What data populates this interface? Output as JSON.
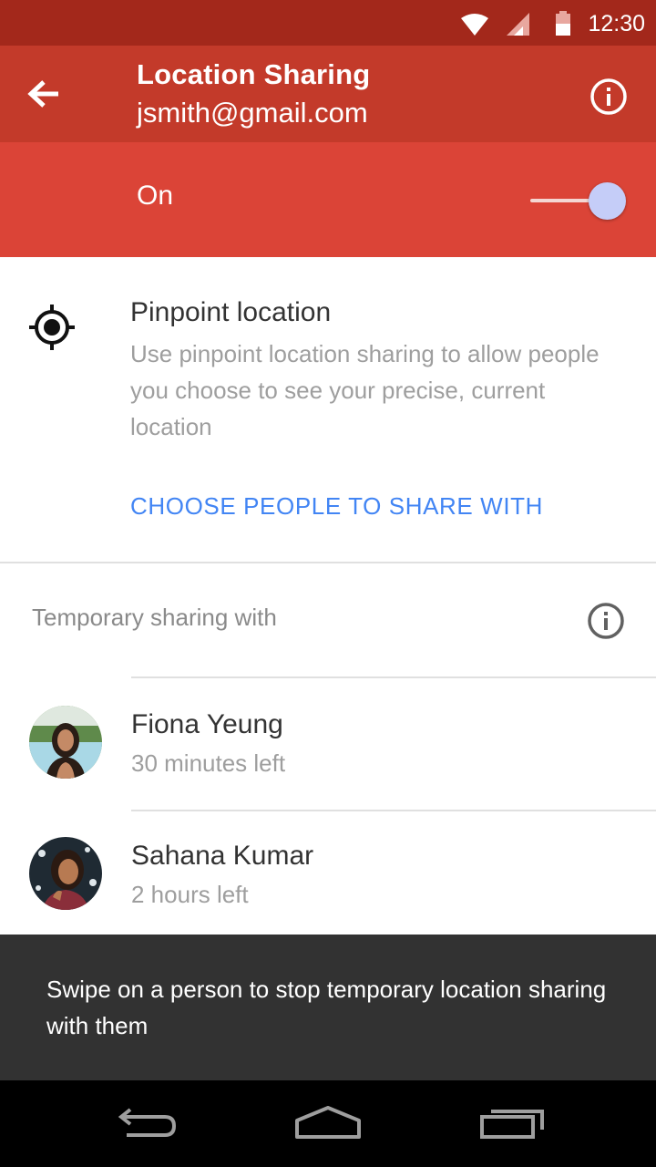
{
  "status_bar": {
    "time": "12:30"
  },
  "app_bar": {
    "title": "Location Sharing",
    "subtitle": "jsmith@gmail.com"
  },
  "toggle": {
    "label": "On",
    "state": "on"
  },
  "pinpoint": {
    "title": "Pinpoint location",
    "description": "Use pinpoint location sharing to allow people you choose to see your precise, current location",
    "action_label": "CHOOSE PEOPLE TO SHARE WITH"
  },
  "temporary": {
    "header": "Temporary sharing with",
    "people": [
      {
        "name": "Fiona Yeung",
        "time_left": "30 minutes left"
      },
      {
        "name": "Sahana Kumar",
        "time_left": "2 hours left"
      }
    ]
  },
  "snackbar": {
    "message": "Swipe on a person to stop temporary location sharing with them"
  },
  "colors": {
    "status_bar": "#a3281b",
    "app_bar": "#c33a2a",
    "toggle_row": "#db4437",
    "link": "#4285f4",
    "snackbar": "#323232"
  }
}
